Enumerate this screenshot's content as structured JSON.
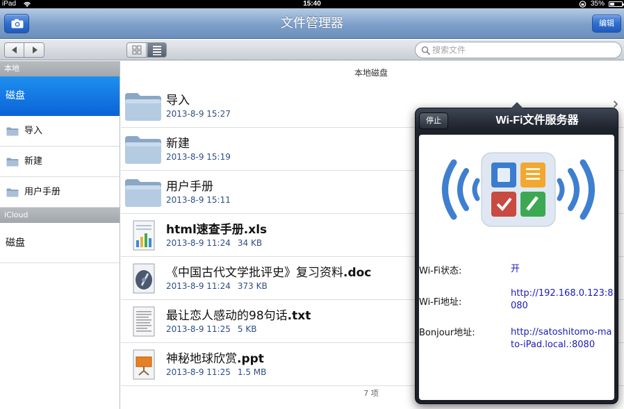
{
  "status_bar": {
    "device": "iPad",
    "time": "15:40",
    "battery": "35%",
    "battery_level": 0.35
  },
  "nav": {
    "title": "文件管理器",
    "edit_label": "编辑"
  },
  "toolbar": {
    "search_placeholder": "搜索文件"
  },
  "sidebar": {
    "local_header": "本地",
    "selected_item": "磁盘",
    "folders": [
      "导入",
      "新建",
      "用户手册"
    ],
    "icloud_header": "iCloud",
    "icloud_item": "磁盘"
  },
  "main": {
    "title": "本地磁盘",
    "files": [
      {
        "name": "导入",
        "date": "2013-8-9 15:27",
        "size": "",
        "type": "folder"
      },
      {
        "name": "新建",
        "date": "2013-8-9 15:19",
        "size": "",
        "type": "folder"
      },
      {
        "name": "用户手册",
        "date": "2013-8-9 15:11",
        "size": "",
        "type": "folder"
      },
      {
        "name_pre": "html速查手册",
        "ext": ".xls",
        "date": "2013-8-9 11:24",
        "size": "34 KB",
        "type": "xls"
      },
      {
        "name_pre": "《中国古代文学批评史》复习资料",
        "ext": ".doc",
        "date": "2013-8-9 11:24",
        "size": "373 KB",
        "type": "doc"
      },
      {
        "name_pre": "最让恋人感动的98句话",
        "ext": ".txt",
        "date": "2013-8-9 11:25",
        "size": "5 KB",
        "type": "txt"
      },
      {
        "name_pre": "神秘地球欣赏",
        "ext": ".ppt",
        "date": "2013-8-9 11:25",
        "size": "1.5 MB",
        "type": "ppt"
      }
    ],
    "count": "7 项"
  },
  "popover": {
    "title": "Wi-Fi文件服务器",
    "stop_label": "停止",
    "wifi_status_label": "Wi-Fi状态:",
    "wifi_status_value": "开",
    "wifi_address_label": "Wi-Fi地址:",
    "wifi_address_value": "http://192.168.0.123:8080",
    "bonjour_label": "Bonjour地址:",
    "bonjour_value": "http://satoshitomo-mato-iPad.local.:8080"
  },
  "colors": {
    "accent": "#0a63d6",
    "link": "#1a1ab8",
    "meta": "#2d4e86"
  }
}
